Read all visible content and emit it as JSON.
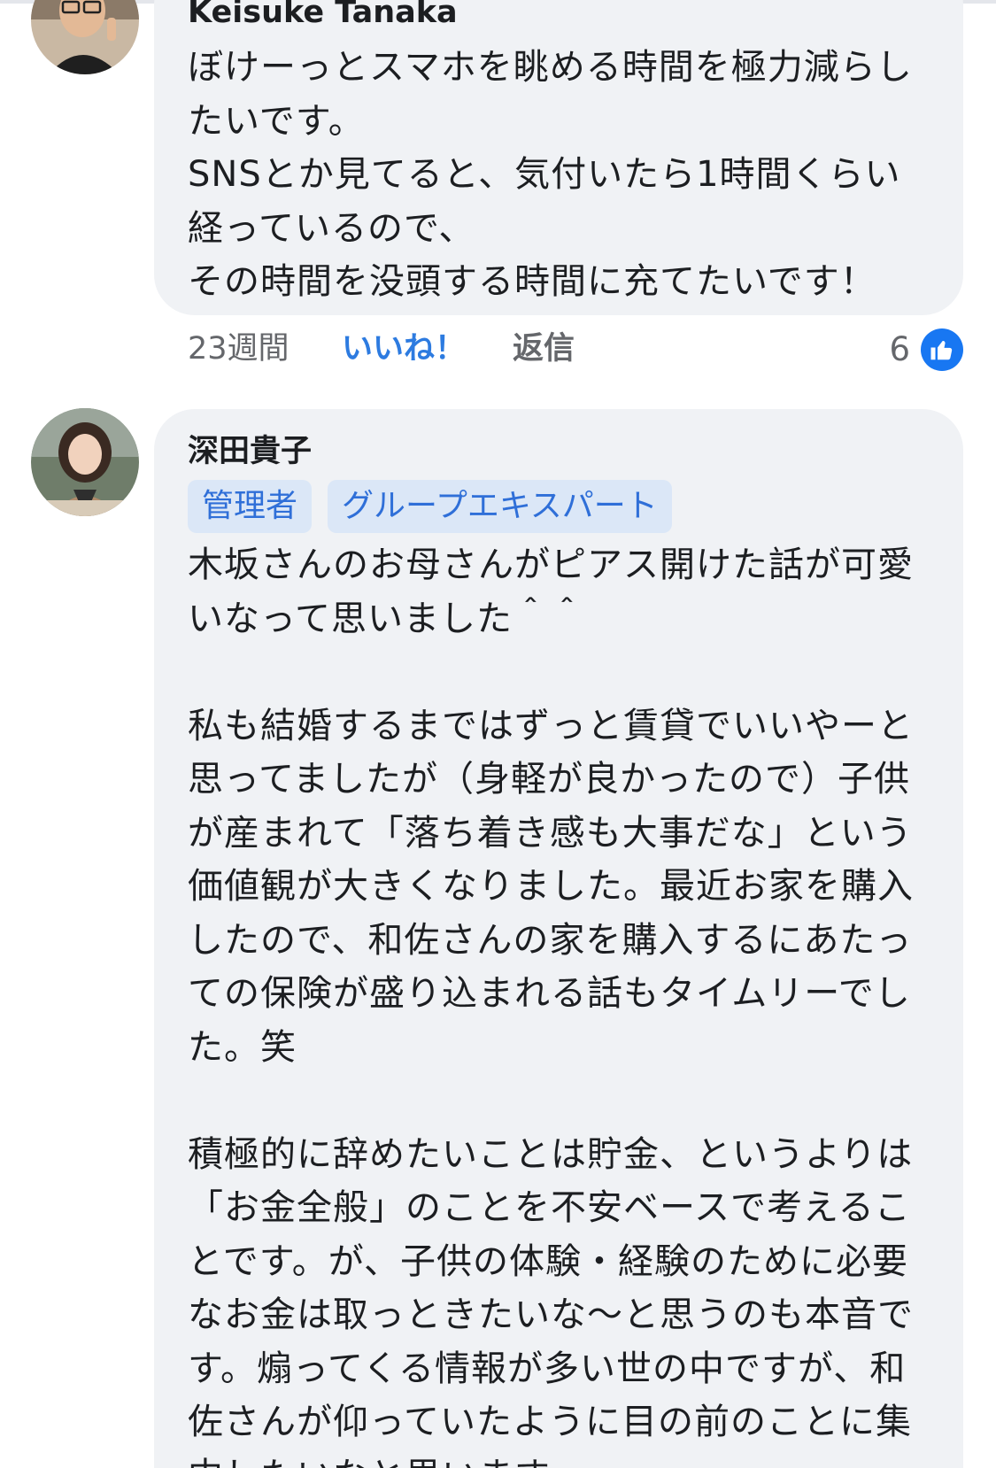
{
  "comments": [
    {
      "author": "Keisuke Tanaka",
      "avatar_icon": "profile-photo",
      "text": "ぼけーっとスマホを眺める時間を極力減らしたいです。\nSNSとか見てると、気付いたら1時間くらい経っているので、\nその時間を没頭する時間に充てたいです！",
      "actions": {
        "time": "23週間",
        "like_label": "いいね！",
        "reply_label": "返信",
        "reaction_count": "6",
        "reaction_icon": "thumbs-up-icon"
      }
    },
    {
      "author": "深田貴子",
      "avatar_icon": "profile-photo",
      "badges": [
        "管理者",
        "グループエキスパート"
      ],
      "text": "木坂さんのお母さんがピアス開けた話が可愛いなって思いました＾＾\n\n私も結婚するまではずっと賃貸でいいやーと思ってましたが（身軽が良かったので）子供が産まれて「落ち着き感も大事だな」という価値観が大きくなりました。最近お家を購入したので、和佐さんの家を購入するにあたっての保険が盛り込まれる話もタイムリーでした。笑\n\n積極的に辞めたいことは貯金、というよりは「お金全般」のことを不安ベースで考えることです。が、子供の体験・経験のために必要なお金は取っときたいな〜と思うのも本音です。煽ってくる情報が多い世の中ですが、和佐さんが仰っていたように目の前のことに集中したいなと思います"
    }
  ],
  "colors": {
    "bubble": "#f0f2f5",
    "accent": "#2d7be0",
    "badge_bg": "#dbe7f7",
    "muted": "#65676b"
  }
}
